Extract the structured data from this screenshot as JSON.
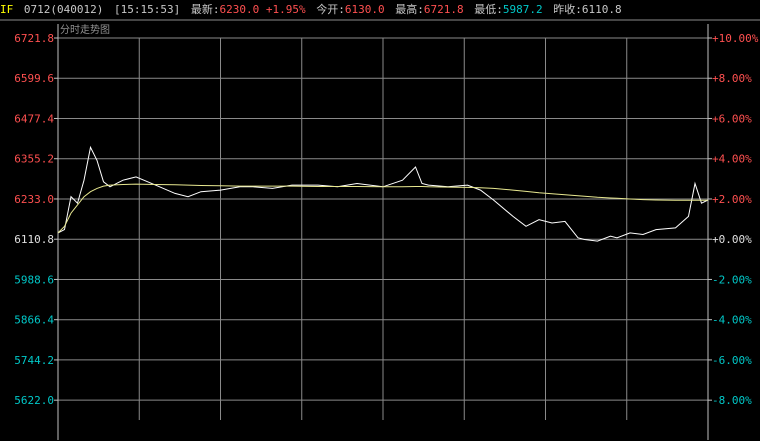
{
  "header": {
    "symbol": "IF",
    "contract": "0712",
    "code": "(040012)",
    "time": "[15:15:53]",
    "latest_label": "最新",
    "latest_value": "6230.0",
    "change_pct": "+1.95%",
    "open_label": "今开",
    "open_value": "6130.0",
    "high_label": "最高",
    "high_value": "6721.8",
    "low_label": "最低",
    "low_value": "5987.2",
    "prev_close_label": "昨收",
    "prev_close_value": "6110.8"
  },
  "chart_data": {
    "type": "line",
    "title": "分时走势图",
    "grid": true,
    "y_range": [
      5561.8,
      6721.8
    ],
    "reference": 6110.8,
    "y_ticks": [
      "6721.8",
      "6599.6",
      "6477.4",
      "6355.2",
      "6233.0",
      "6110.8",
      "5988.6",
      "5866.4",
      "5744.2",
      "5622.0"
    ],
    "y_ticks_right": [
      "+10.00%",
      "+8.00%",
      "+6.00%",
      "+4.00%",
      "+2.00%",
      "+0.00%",
      "-2.00%",
      "-4.00%",
      "-6.00%",
      "-8.00%"
    ],
    "x": [
      0,
      0.01,
      0.02,
      0.03,
      0.04,
      0.05,
      0.06,
      0.07,
      0.08,
      0.1,
      0.12,
      0.15,
      0.18,
      0.2,
      0.22,
      0.25,
      0.28,
      0.3,
      0.33,
      0.36,
      0.4,
      0.43,
      0.46,
      0.5,
      0.53,
      0.55,
      0.56,
      0.57,
      0.6,
      0.63,
      0.65,
      0.67,
      0.7,
      0.72,
      0.74,
      0.76,
      0.78,
      0.8,
      0.81,
      0.83,
      0.85,
      0.86,
      0.88,
      0.9,
      0.92,
      0.95,
      0.97,
      0.98,
      0.99,
      1.0
    ],
    "series": [
      {
        "color": "#ffffff",
        "values": [
          6130,
          6140,
          6240,
          6220,
          6290,
          6390,
          6350,
          6285,
          6270,
          6290,
          6300,
          6275,
          6250,
          6240,
          6255,
          6260,
          6270,
          6270,
          6265,
          6275,
          6275,
          6270,
          6280,
          6270,
          6290,
          6330,
          6280,
          6275,
          6270,
          6275,
          6260,
          6230,
          6180,
          6150,
          6170,
          6160,
          6165,
          6115,
          6110,
          6105,
          6120,
          6115,
          6130,
          6125,
          6140,
          6145,
          6180,
          6280,
          6220,
          6230
        ]
      },
      {
        "color": "#e8e890",
        "values": [
          6130,
          6150,
          6190,
          6215,
          6240,
          6255,
          6265,
          6272,
          6275,
          6277,
          6278,
          6277,
          6276,
          6275,
          6274,
          6273,
          6272,
          6272,
          6272,
          6272,
          6271,
          6271,
          6271,
          6270,
          6270,
          6271,
          6271,
          6270,
          6269,
          6268,
          6267,
          6265,
          6260,
          6256,
          6252,
          6249,
          6246,
          6243,
          6241,
          6238,
          6236,
          6235,
          6233,
          6231,
          6230,
          6229,
          6229,
          6229,
          6229,
          6229
        ]
      }
    ]
  },
  "colors": {
    "background": "#000000",
    "grid": "#8a8a8a",
    "axis": "#c0c0c0",
    "up": "#ff5050",
    "neutral": "#e0e0e0",
    "down": "#00c8c8",
    "symbol": "#ffff00",
    "header_text": "#c8c8c8"
  }
}
